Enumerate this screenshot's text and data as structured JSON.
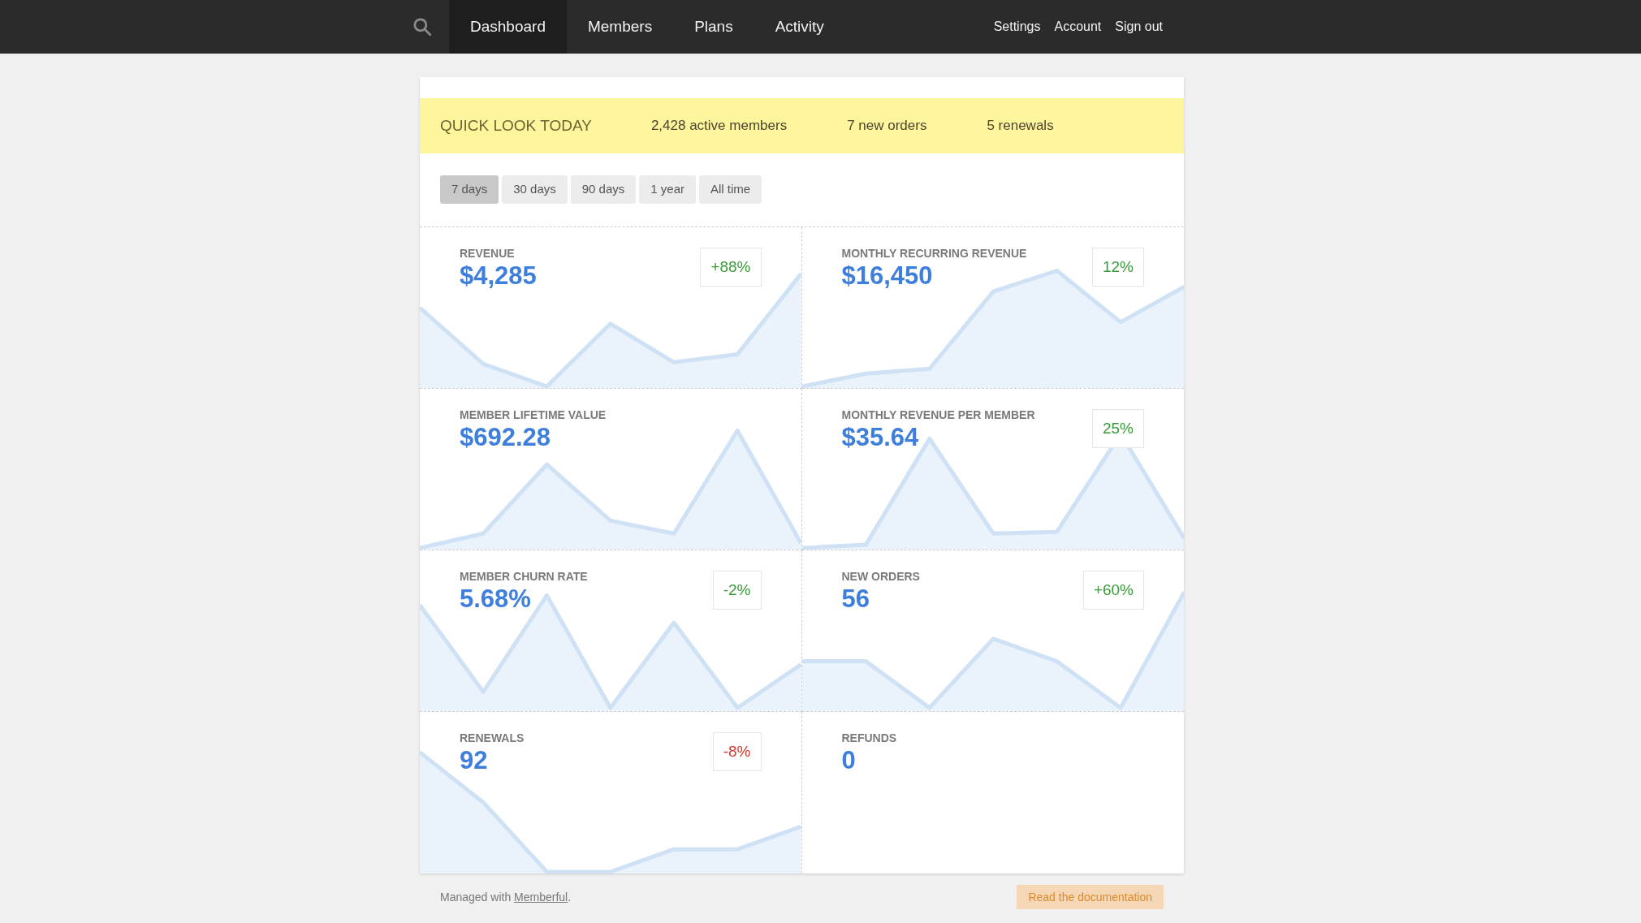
{
  "nav": {
    "items": [
      {
        "label": "Dashboard",
        "selected": true
      },
      {
        "label": "Members",
        "selected": false
      },
      {
        "label": "Plans",
        "selected": false
      },
      {
        "label": "Activity",
        "selected": false
      }
    ],
    "links": [
      "Settings",
      "Account",
      "Sign out"
    ]
  },
  "quick_look": {
    "title": "QUICK LOOK TODAY",
    "stats": [
      "2,428 active members",
      "7 new orders",
      "5 renewals"
    ]
  },
  "ranges": [
    {
      "label": "7 days",
      "selected": true
    },
    {
      "label": "30 days",
      "selected": false
    },
    {
      "label": "90 days",
      "selected": false
    },
    {
      "label": "1 year",
      "selected": false
    },
    {
      "label": "All time",
      "selected": false
    }
  ],
  "tiles": [
    {
      "kind": "chart",
      "label": "REVENUE",
      "value": "$4,285",
      "delta": "+88%",
      "color": "#3b9a3b"
    },
    {
      "kind": "chart",
      "label": "MONTHLY RECURRING REVENUE",
      "value": "$16,450",
      "delta": "12%",
      "color": "#3b9a3b"
    },
    {
      "kind": "chart",
      "label": "MEMBER LIFETIME VALUE",
      "value": "$692.28"
    },
    {
      "kind": "chart",
      "label": "MONTHLY REVENUE PER MEMBER",
      "value": "$35.64",
      "delta": "25%",
      "color": "#3b9a3b"
    },
    {
      "kind": "chart",
      "label": "MEMBER CHURN RATE",
      "value": "5.68%",
      "delta": "-2%",
      "color": "#3b9a3b"
    },
    {
      "kind": "chart",
      "label": "NEW ORDERS",
      "value": "56",
      "delta": "+60%",
      "color": "#3b9a3b"
    },
    {
      "kind": "chart",
      "label": "RENEWALS",
      "value": "92",
      "delta": "-8%",
      "color": "#d0392b"
    },
    {
      "kind": "empty",
      "label": "REFUNDS",
      "value": "0"
    }
  ],
  "footer": {
    "prefix": "Managed with ",
    "link": "Memberful",
    "suffix": ".",
    "button": "Read the documentation"
  }
}
